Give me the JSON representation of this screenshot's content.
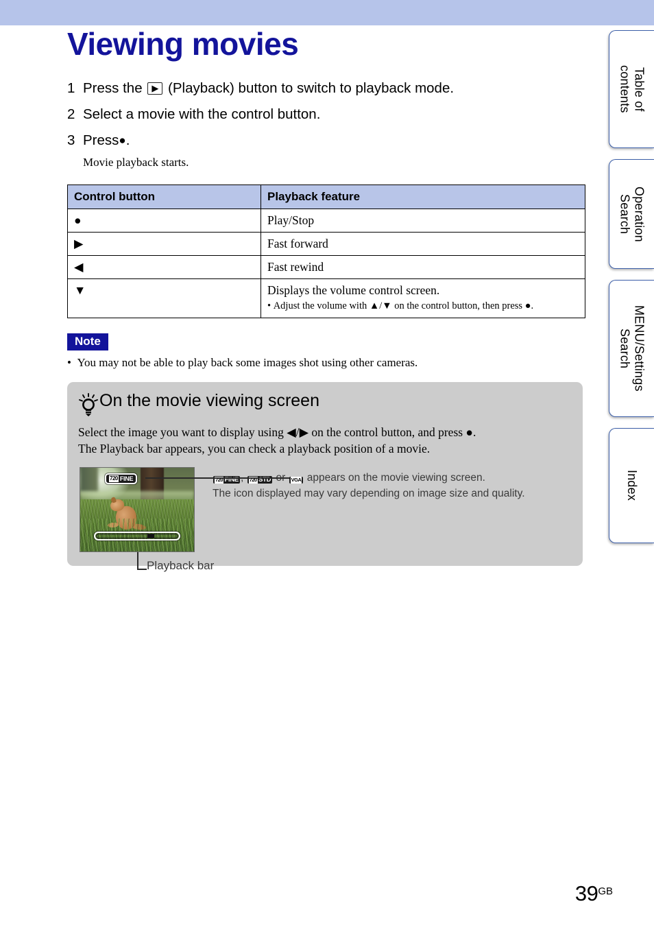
{
  "document": {
    "title": "Viewing movies",
    "page_number": "39",
    "page_suffix": "GB"
  },
  "side_tabs": [
    {
      "label": "Table of\ncontents"
    },
    {
      "label": "Operation\nSearch"
    },
    {
      "label": "MENU/Settings\nSearch"
    },
    {
      "label": "Index"
    }
  ],
  "steps": [
    {
      "num": "1",
      "text_before": "Press the",
      "icon": "playback-button-icon",
      "icon_glyph": "▶",
      "text_after": "(Playback) button to switch to playback mode."
    },
    {
      "num": "2",
      "text_before": "Select a movie with the control button.",
      "icon": "",
      "icon_glyph": "",
      "text_after": ""
    },
    {
      "num": "3",
      "text_before": "Press",
      "icon": "center-button-icon",
      "icon_glyph": "●",
      "text_after": "."
    }
  ],
  "step_subnote": "Movie playback starts.",
  "table": {
    "headers": [
      "Control button",
      "Playback feature"
    ],
    "rows": [
      {
        "button": "●",
        "button_name": "center-button-glyph",
        "feature": "Play/Stop",
        "sub": ""
      },
      {
        "button": "▶",
        "button_name": "right-arrow-glyph",
        "feature": "Fast forward",
        "sub": ""
      },
      {
        "button": "◀",
        "button_name": "left-arrow-glyph",
        "feature": "Fast rewind",
        "sub": ""
      },
      {
        "button": "▼",
        "button_name": "down-arrow-glyph",
        "feature": "Displays the volume control screen.",
        "sub": "Adjust the volume with ▲/▼ on the control button, then press ●."
      }
    ]
  },
  "note": {
    "badge": "Note",
    "items": [
      "You may not be able to play back some images shot using other cameras."
    ]
  },
  "tip": {
    "title": "On the movie viewing screen",
    "paragraph_line1": "Select the image you want to display using ◀/▶ on the control button, and press ●.",
    "paragraph_line2": "The Playback bar appears, you can check a playback position of a movie.",
    "figure": {
      "thumbnail_badge": {
        "size": "720",
        "quality": "FINE"
      },
      "playback_bar_caption": "Playback bar",
      "badges": [
        {
          "size": "720",
          "quality": "FINE"
        },
        {
          "size": "720",
          "quality": "STD"
        },
        {
          "size": "VGA",
          "quality": ""
        }
      ],
      "separator": ",",
      "conjunction": "or",
      "caption_line1_tail": "appears on the movie viewing screen.",
      "caption_line2": "The icon displayed may vary depending on image size and quality."
    }
  },
  "colors": {
    "banner": "#b6c4ea",
    "table_header": "#b8c5e8",
    "title": "#13149b",
    "note_badge": "#13149b",
    "tip_box": "#cccccc",
    "tab_border": "#3b5ea8"
  }
}
